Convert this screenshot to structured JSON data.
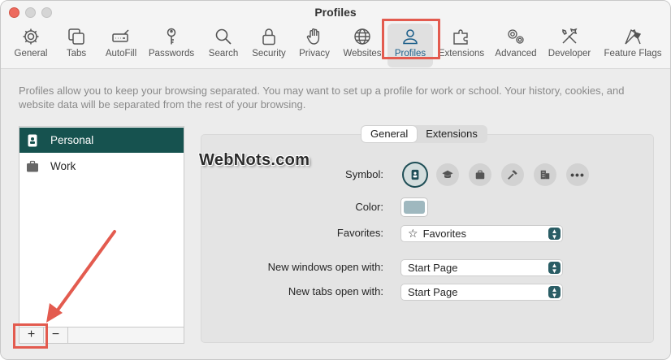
{
  "window": {
    "title": "Profiles"
  },
  "toolbar": {
    "items": [
      {
        "label": "General",
        "icon": "gear-icon"
      },
      {
        "label": "Tabs",
        "icon": "tabs-icon"
      },
      {
        "label": "AutoFill",
        "icon": "autofill-icon"
      },
      {
        "label": "Passwords",
        "icon": "key-icon"
      },
      {
        "label": "Search",
        "icon": "search-icon"
      },
      {
        "label": "Security",
        "icon": "lock-icon"
      },
      {
        "label": "Privacy",
        "icon": "hand-icon"
      },
      {
        "label": "Websites",
        "icon": "globe-icon"
      },
      {
        "label": "Profiles",
        "icon": "profile-icon",
        "active": true
      },
      {
        "label": "Extensions",
        "icon": "extensions-icon"
      },
      {
        "label": "Advanced",
        "icon": "gears-icon"
      },
      {
        "label": "Developer",
        "icon": "tools-icon"
      },
      {
        "label": "Feature Flags",
        "icon": "flags-icon"
      }
    ]
  },
  "intro": {
    "text": "Profiles allow you to keep your browsing separated. You may want to set up a profile for work or school. Your history, cookies, and website data will be separated from the rest of your browsing."
  },
  "profiles": {
    "items": [
      {
        "label": "Personal",
        "icon": "id-badge-icon",
        "selected": true
      },
      {
        "label": "Work",
        "icon": "briefcase-icon",
        "selected": false
      }
    ],
    "add_label": "+",
    "remove_label": "−"
  },
  "tabs": {
    "general": "General",
    "extensions": "Extensions"
  },
  "watermark": "WebNots.com",
  "form": {
    "symbol_label": "Symbol:",
    "color_label": "Color:",
    "color_value": "#9fb8bf",
    "favorites_label": "Favorites:",
    "favorites_value": "Favorites",
    "new_windows_label": "New windows open with:",
    "new_windows_value": "Start Page",
    "new_tabs_label": "New tabs open with:",
    "new_tabs_value": "Start Page",
    "symbols": [
      "id-badge-icon",
      "graduation-cap-icon",
      "briefcase-icon",
      "hammer-icon",
      "building-icon",
      "more-icon"
    ],
    "more_label": "•••"
  },
  "colors": {
    "accent": "#16524f",
    "annotation": "#e35b4f"
  }
}
